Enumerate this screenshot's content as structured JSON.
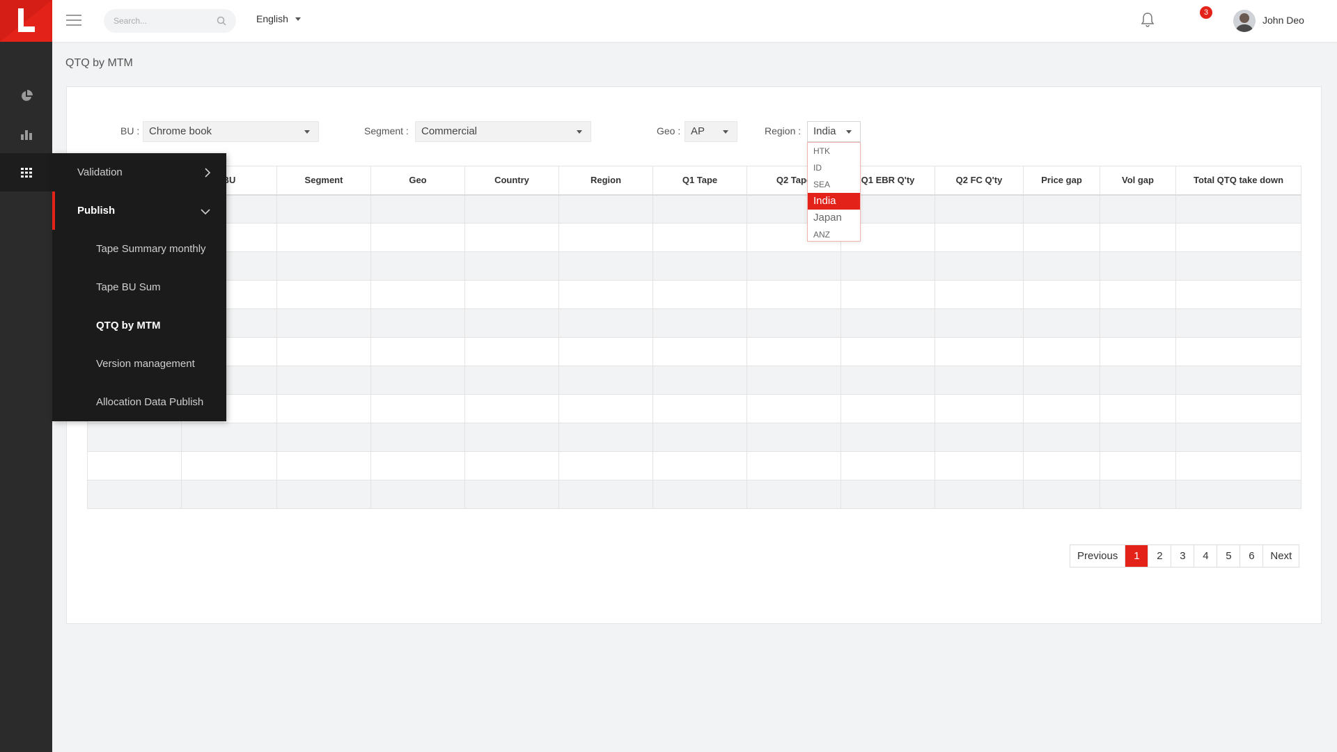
{
  "topbar": {
    "search_placeholder": "Search...",
    "language": "English",
    "notification_count": "3",
    "user_name": "John Deo"
  },
  "page": {
    "title": "QTQ by MTM"
  },
  "filters": {
    "bu": {
      "label": "BU :",
      "value": "Chrome book"
    },
    "segment": {
      "label": "Segment :",
      "value": "Commercial"
    },
    "geo": {
      "label": "Geo :",
      "value": "AP"
    },
    "region": {
      "label": "Region :",
      "value": "India",
      "options": [
        "HTK",
        "ID",
        "SEA",
        "India",
        "Japan",
        "ANZ"
      ]
    }
  },
  "table": {
    "columns": [
      "",
      "BU",
      "Segment",
      "Geo",
      "Country",
      "Region",
      "Q1 Tape",
      "Q2 Tape",
      "Q1 EBR Q'ty",
      "Q2 FC Q'ty",
      "Price gap",
      "Vol gap",
      "Total QTQ take down"
    ]
  },
  "menu": {
    "parents": [
      {
        "label": "Validation"
      },
      {
        "label": "Publish"
      }
    ],
    "children": [
      {
        "label": "Tape Summary monthly"
      },
      {
        "label": "Tape BU Sum"
      },
      {
        "label": "QTQ by MTM"
      },
      {
        "label": "Version management"
      },
      {
        "label": "Allocation Data Publish"
      }
    ]
  },
  "pagination": {
    "previous": "Previous",
    "pages": [
      "1",
      "2",
      "3",
      "4",
      "5",
      "6"
    ],
    "next": "Next",
    "current": "1"
  },
  "colors": {
    "accent": "#e32219",
    "sidebar": "#2b2b2b",
    "flyout": "#1b1b1b"
  }
}
